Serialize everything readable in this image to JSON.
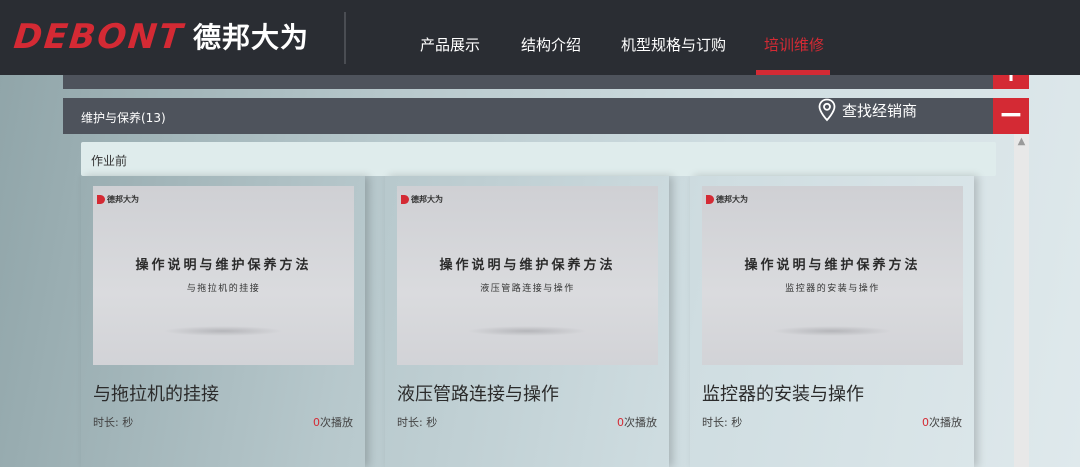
{
  "header": {
    "logo_mark": "DEBONT",
    "logo_cn": "德邦大为",
    "nav": [
      {
        "label": "产品展示",
        "active": false
      },
      {
        "label": "结构介绍",
        "active": false
      },
      {
        "label": "机型规格与订购",
        "active": false
      },
      {
        "label": "培训维修",
        "active": true
      }
    ]
  },
  "accordion_top": {
    "title": "",
    "toggle": "+"
  },
  "accordion_main": {
    "title": "维护与保养(13)",
    "toggle": "−"
  },
  "dealer": {
    "label": "查找经销商",
    "icon": "location-pin-icon"
  },
  "section": {
    "title": "作业前"
  },
  "cards": [
    {
      "thumb_brand": "德邦大为",
      "thumb_title": "操作说明与维护保养方法",
      "thumb_subtitle": "与拖拉机的挂接",
      "title": "与拖拉机的挂接",
      "duration": "时长: 秒",
      "plays_count": "0",
      "plays_suffix": "次播放"
    },
    {
      "thumb_brand": "德邦大为",
      "thumb_title": "操作说明与维护保养方法",
      "thumb_subtitle": "液压管路连接与操作",
      "title": "液压管路连接与操作",
      "duration": "时长: 秒",
      "plays_count": "0",
      "plays_suffix": "次播放"
    },
    {
      "thumb_brand": "德邦大为",
      "thumb_title": "操作说明与维护保养方法",
      "thumb_subtitle": "监控器的安装与操作",
      "title": "监控器的安装与操作",
      "duration": "时长: 秒",
      "plays_count": "0",
      "plays_suffix": "次播放"
    }
  ],
  "colors": {
    "header_bg": "#2a2d33",
    "accent": "#d42a34",
    "accordion_bg": "#4e535c",
    "section_bg": "#dfecec"
  }
}
